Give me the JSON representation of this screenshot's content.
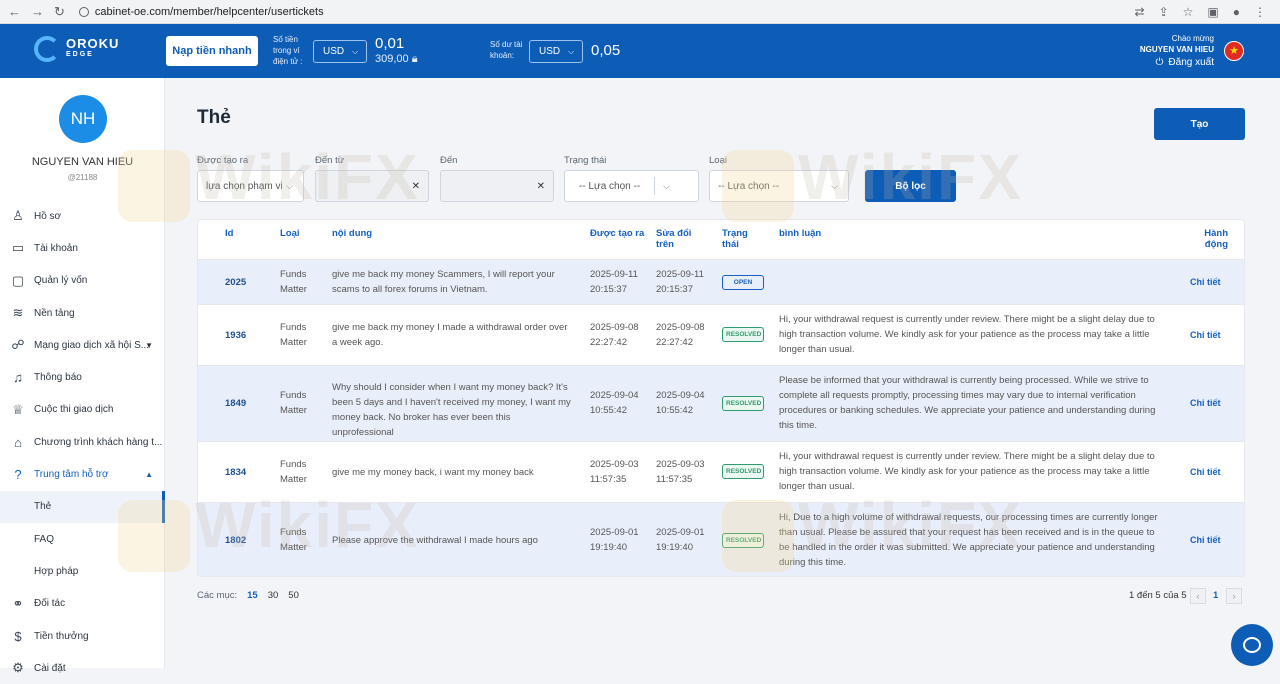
{
  "browser": {
    "url": "cabinet-oe.com/member/helpcenter/usertickets"
  },
  "header": {
    "logo_text": "OROKU",
    "logo_sub": "EDGE",
    "deposit_button": "Nạp tiền nhanh",
    "wallet_label": "Số tiền trong ví điện tử :",
    "wallet_currency": "USD",
    "wallet_amount": "0,01",
    "wallet_locked": "309,00",
    "account_label": "Số dư tài khoản:",
    "account_currency": "USD",
    "account_amount": "0,05",
    "welcome_label": "Chào mừng",
    "welcome_name": "NGUYEN VAN HIEU",
    "logout_label": "Đăng xuất",
    "flag_icon": "vietnam-flag-icon"
  },
  "sidebar": {
    "avatar_initials": "NH",
    "user_name": "NGUYEN VAN HIEU",
    "user_id": "@21188",
    "items": [
      {
        "label": "Hồ sơ",
        "icon": "user-icon"
      },
      {
        "label": "Tài khoản",
        "icon": "card-icon"
      },
      {
        "label": "Quản lý vốn",
        "icon": "wallet-icon"
      },
      {
        "label": "Nền tảng",
        "icon": "layers-icon"
      },
      {
        "label": "Mạng giao dịch xã hội S...",
        "icon": "network-icon"
      },
      {
        "label": "Thông báo",
        "icon": "bell-icon"
      },
      {
        "label": "Cuộc thi giao dịch",
        "icon": "trophy-icon"
      },
      {
        "label": "Chương trình khách hàng t...",
        "icon": "gift-icon"
      },
      {
        "label": "Trung tâm hỗ trợ",
        "icon": "help-icon"
      },
      {
        "label": "Thẻ"
      },
      {
        "label": "FAQ"
      },
      {
        "label": "Hợp pháp"
      },
      {
        "label": "Đối tác",
        "icon": "handshake-icon"
      },
      {
        "label": "Tiền thưởng",
        "icon": "dollar-icon"
      },
      {
        "label": "Cài đặt",
        "icon": "gear-icon"
      }
    ]
  },
  "main": {
    "title": "Thẻ",
    "create_button": "Tạo",
    "filters": {
      "created_label": "Được tạo ra",
      "created_value": "lựa chọn phạm vi",
      "from_label": "Đến từ",
      "to_label": "Đến",
      "status_label": "Trạng thái",
      "status_value": "-- Lựa chọn --",
      "type_label": "Loại",
      "type_value": "-- Lựa chọn --",
      "filter_button": "Bộ lọc"
    },
    "table": {
      "headers": {
        "id": "Id",
        "type": "Loại",
        "content": "nội dung",
        "created": "Được tạo ra",
        "modified": "Sửa đổi trên",
        "status": "Trạng thái",
        "comment": "bình luận",
        "action": "Hành động"
      },
      "rows": [
        {
          "id": "2025",
          "type": "Funds Matter",
          "content": "give me back my money Scammers, I will report your scams to all forex forums in Vietnam.",
          "created": "2025-09-11 20:15:37",
          "modified": "2025-09-11 20:15:37",
          "status": "OPEN",
          "comment": "",
          "action": "Chi tiết"
        },
        {
          "id": "1936",
          "type": "Funds Matter",
          "content": "give me back my money I made a withdrawal order over a week ago.",
          "created": "2025-09-08 22:27:42",
          "modified": "2025-09-08 22:27:42",
          "status": "RESOLVED",
          "comment": "Hi, your withdrawal request is currently under review. There might be a slight delay due to high transaction volume. We kindly ask for your patience as the process may take a little longer than usual.",
          "action": "Chi tiết"
        },
        {
          "id": "1849",
          "type": "Funds Matter",
          "content": "Why should I consider when I want my money back? It's been 5 days and I haven't received my money, I want my money back. No broker has ever been this unprofessional",
          "created": "2025-09-04 10:55:42",
          "modified": "2025-09-04 10:55:42",
          "status": "RESOLVED",
          "comment": "Please be informed that your withdrawal is currently being processed. While we strive to complete all requests promptly, processing times may vary due to internal verification procedures or banking schedules. We appreciate your patience and understanding during this time.",
          "action": "Chi tiết"
        },
        {
          "id": "1834",
          "type": "Funds Matter",
          "content": "give me my money back, i want my money back",
          "created": "2025-09-03 11:57:35",
          "modified": "2025-09-03 11:57:35",
          "status": "RESOLVED",
          "comment": "Hi, your withdrawal request is currently under review. There might be a slight delay due to high transaction volume. We kindly ask for your patience as the process may take a little longer than usual.",
          "action": "Chi tiết"
        },
        {
          "id": "1802",
          "type": "Funds Matter",
          "content": "Please approve the withdrawal I made hours ago",
          "created": "2025-09-01 19:19:40",
          "modified": "2025-09-01 19:19:40",
          "status": "RESOLVED",
          "comment": "Hi, Due to a high volume of withdrawal requests, our processing times are currently longer than usual. Please be assured that your request has been received and is in the queue to be handled in the order it was submitted. We appreciate your patience and understanding during this time.",
          "action": "Chi tiết"
        }
      ]
    },
    "pagination": {
      "per_page_label": "Các mục:",
      "options": [
        "15",
        "30",
        "50"
      ],
      "info": "1 đến 5 của 5",
      "current_page": "1"
    }
  },
  "watermark": "WikiFX"
}
